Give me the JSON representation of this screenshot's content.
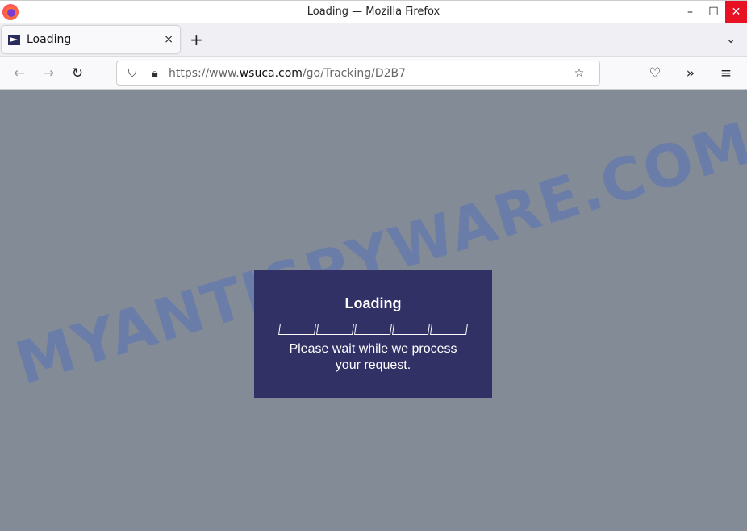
{
  "window": {
    "title": "Loading — Mozilla Firefox"
  },
  "tab": {
    "label": "Loading",
    "close": "×",
    "new_tab": "+",
    "list": "⌄"
  },
  "nav": {
    "back": "←",
    "forward": "→",
    "reload": "↻",
    "url_prefix": "https://www.",
    "url_domain": "wsuca.com",
    "url_path": "/go/Tracking/D2B7",
    "bookmark": "☆",
    "pocket": "♡",
    "extensions": "»",
    "menu": "≡"
  },
  "page": {
    "heading": "Loading",
    "message": "Please wait while we process your request.",
    "progress_segments": 5,
    "progress_filled": 0,
    "background": "#838b97",
    "box_color": "#323166"
  },
  "watermark": "MYANTISPYWARE.COM"
}
